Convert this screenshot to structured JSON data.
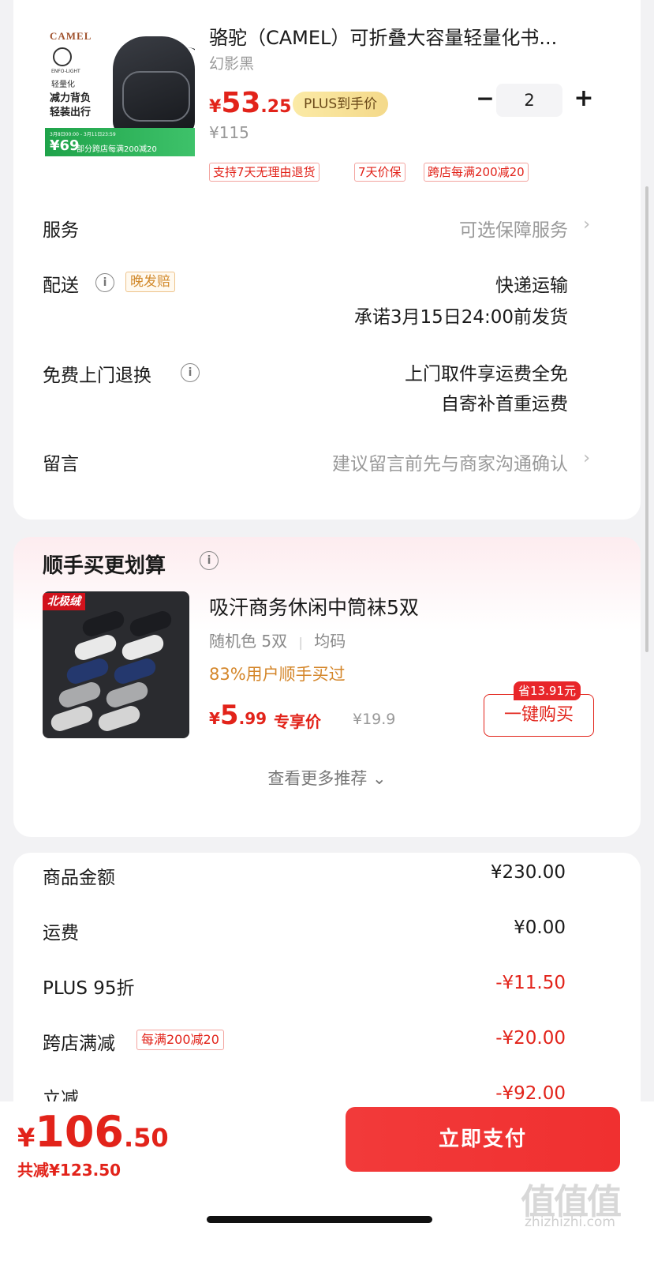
{
  "product": {
    "image_brand": "CAMEL",
    "image_enfo": "ENFO-LIGHT",
    "image_light": "轻量化",
    "image_slogan_1": "减力背负",
    "image_slogan_2": "轻装出行",
    "image_promo_date": "3月8日00:00 - 3月11日23:59",
    "image_promo_price": "¥69",
    "image_promo_text": "部分跨店每满200减20",
    "title": "骆驼（CAMEL）可折叠大容量轻量化书...",
    "variant": "幻影黑",
    "price_symbol": "¥",
    "price_int": "53",
    "price_dec": ".25",
    "plus_badge": "PLUS到手价",
    "original_price": "¥115",
    "quantity": "2",
    "qty_minus": "−",
    "qty_plus": "+",
    "tags": [
      "支持7天无理由退货",
      "7天价保",
      "跨店每满200减20"
    ]
  },
  "rows": {
    "service_label": "服务",
    "service_value": "可选保障服务",
    "delivery_label": "配送",
    "late_badge": "晚发赔",
    "delivery_method": "快递运输",
    "delivery_promise": "承诺3月15日24:00前发货",
    "return_label": "免费上门退换",
    "return_line1": "上门取件享运费全免",
    "return_line2": "自寄补首重运费",
    "message_label": "留言",
    "message_placeholder": "建议留言前先与商家沟通确认",
    "chevron": "›",
    "info": "i"
  },
  "addon": {
    "heading": "顺手买更划算",
    "image_logo": "北极绒",
    "title": "吸汗商务休闲中筒袜5双",
    "spec_color": "随机色 5双",
    "spec_sep": "|",
    "spec_size": "均码",
    "bought": "83%用户顺手买过",
    "price_symbol": "¥",
    "price_int": "5",
    "price_dec": ".99",
    "exclusive": "专享价",
    "original_price": "¥19.9",
    "save_tag": "省13.91元",
    "buy_button": "一键购买",
    "see_more": "查看更多推荐 ⌄"
  },
  "summary": {
    "items": [
      {
        "label": "商品金额",
        "value": "¥230.00",
        "negative": false
      },
      {
        "label": "运费",
        "value": "¥0.00",
        "negative": false
      },
      {
        "label": "PLUS 95折",
        "value": "-¥11.50",
        "negative": true
      },
      {
        "label": "跨店满减",
        "value": "-¥20.00",
        "negative": true,
        "badge": "每满200减20"
      },
      {
        "label": "立减",
        "value": "-¥92.00",
        "negative": true
      }
    ]
  },
  "footer": {
    "total_symbol": "¥",
    "total_int": "106",
    "total_dec": ".50",
    "total_saved": "共减¥123.50",
    "pay_button": "立即支付"
  },
  "watermark": {
    "logo": "值值值",
    "url": "zhizhizhi.com"
  },
  "colors": {
    "accent_red": "#e2231a",
    "plus_gold": "#f4d98a",
    "bought_orange": "#d4862a"
  }
}
